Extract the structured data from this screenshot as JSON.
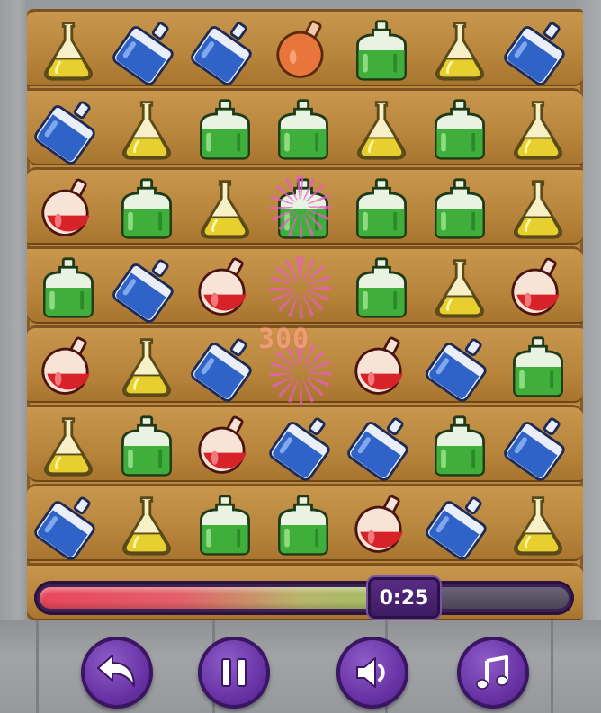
{
  "game": {
    "board": {
      "rows": [
        [
          "yellow-flask",
          "blue-bottle",
          "blue-bottle",
          "orange-round-flask",
          "green-jug",
          "yellow-flask",
          "blue-bottle"
        ],
        [
          "blue-bottle",
          "yellow-flask",
          "green-jug",
          "green-jug",
          "yellow-flask",
          "green-jug",
          "yellow-flask"
        ],
        [
          "red-round-flask",
          "green-jug",
          "yellow-flask",
          "green-jug",
          "green-jug",
          "green-jug",
          "yellow-flask"
        ],
        [
          "green-jug",
          "blue-bottle",
          "red-round-flask",
          "empty",
          "green-jug",
          "yellow-flask",
          "red-round-flask"
        ],
        [
          "red-round-flask",
          "yellow-flask",
          "blue-bottle",
          "empty",
          "red-round-flask",
          "blue-bottle",
          "green-jug"
        ],
        [
          "yellow-flask",
          "green-jug",
          "red-round-flask",
          "blue-bottle",
          "blue-bottle",
          "green-jug",
          "blue-bottle"
        ],
        [
          "blue-bottle",
          "yellow-flask",
          "green-jug",
          "green-jug",
          "red-round-flask",
          "blue-bottle",
          "yellow-flask"
        ]
      ]
    },
    "score_popup": "300",
    "timer": {
      "label": "0:25",
      "remaining_fraction": 0.76
    },
    "controls": [
      {
        "name": "back-button",
        "icon": "back-arrow-icon"
      },
      {
        "name": "pause-button",
        "icon": "pause-icon"
      },
      {
        "name": "sound-button",
        "icon": "speaker-icon"
      },
      {
        "name": "music-button",
        "icon": "music-note-icon"
      }
    ],
    "colors": {
      "button_purple": "#6a34a6",
      "timer_red": "#e8465c",
      "timer_green": "#92c262",
      "popup_orange": "#f0a27c",
      "sparkle_pink": "#ec5ac8"
    }
  }
}
